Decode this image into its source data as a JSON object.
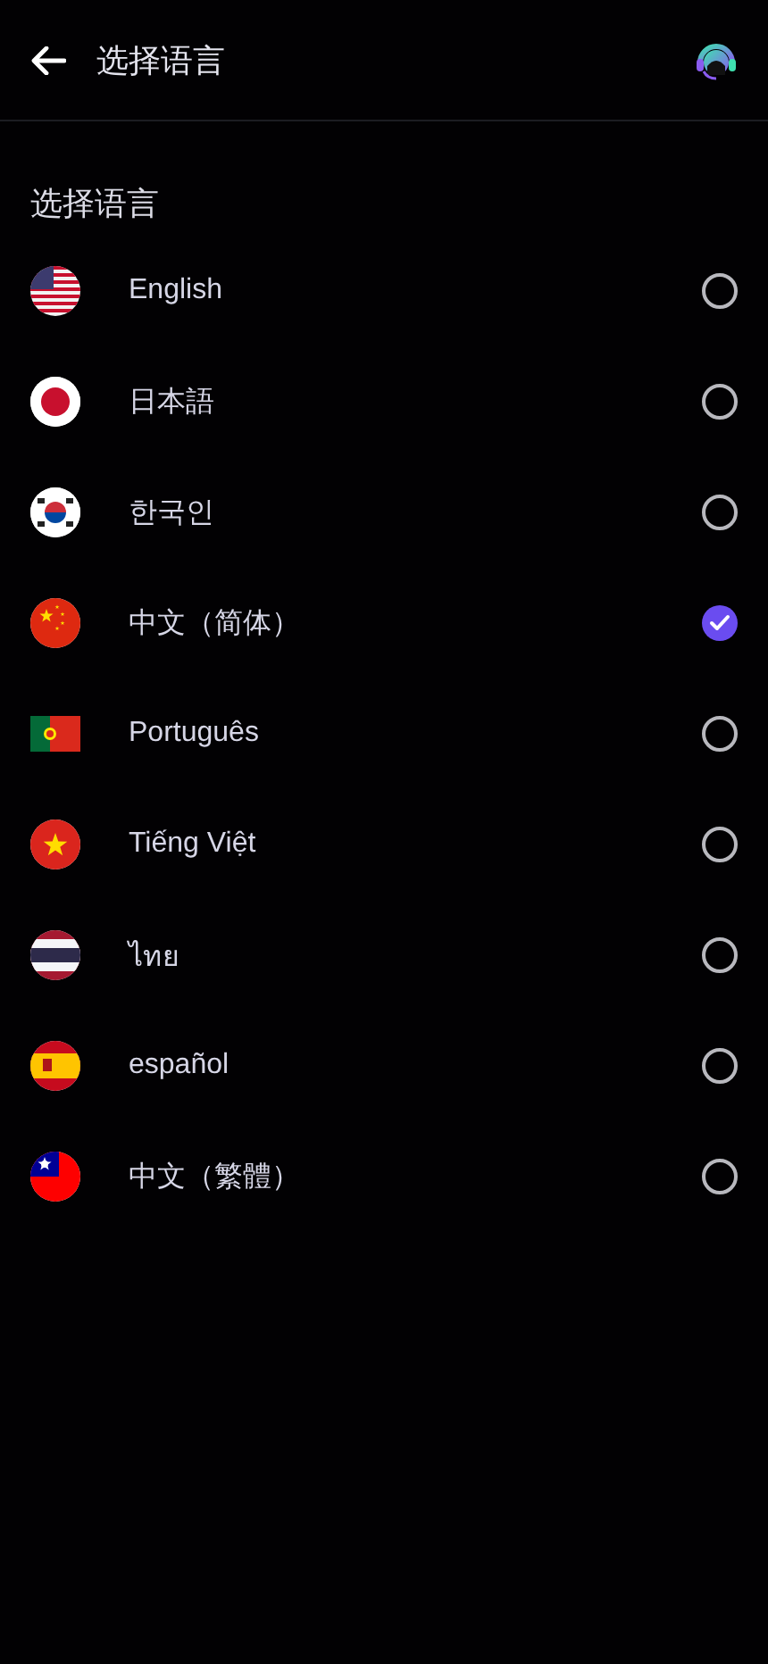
{
  "header": {
    "title": "选择语言"
  },
  "section_title": "选择语言",
  "languages": [
    {
      "label": "English",
      "kind": "us",
      "selected": false
    },
    {
      "label": "日本語",
      "kind": "jp",
      "selected": false
    },
    {
      "label": "한국인",
      "kind": "kr",
      "selected": false
    },
    {
      "label": "中文（简体）",
      "kind": "cn",
      "selected": true
    },
    {
      "label": "Português",
      "kind": "pt",
      "selected": false
    },
    {
      "label": "Tiếng Việt",
      "kind": "vn",
      "selected": false
    },
    {
      "label": "ไทย",
      "kind": "th",
      "selected": false
    },
    {
      "label": "español",
      "kind": "es",
      "selected": false
    },
    {
      "label": "中文（繁體）",
      "kind": "tw",
      "selected": false
    }
  ]
}
